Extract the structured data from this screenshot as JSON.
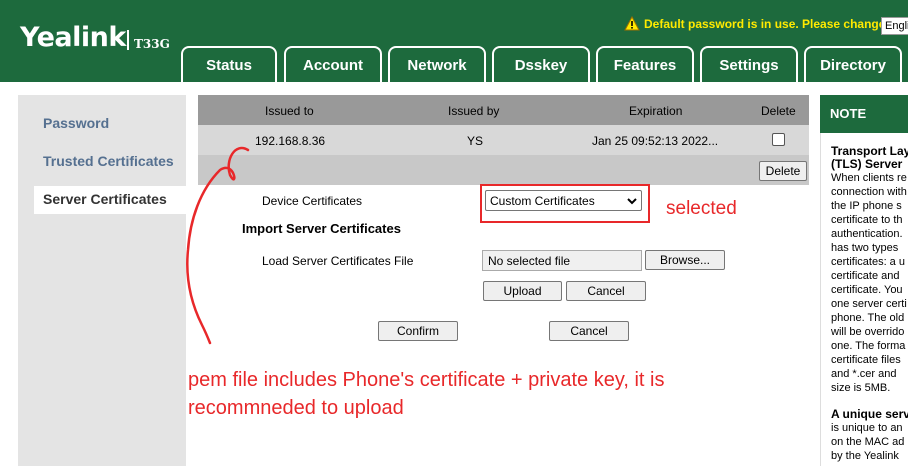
{
  "header": {
    "logo": "Yealink",
    "model": "T33G",
    "warning": "Default password is in use. Please change!",
    "language": "English",
    "tabs": [
      "Status",
      "Account",
      "Network",
      "Dsskey",
      "Features",
      "Settings",
      "Directory"
    ],
    "active_tab": "Settings"
  },
  "sidebar": {
    "items": [
      "Password",
      "Trusted Certificates",
      "Server Certificates"
    ],
    "active": "Server Certificates"
  },
  "cert_table": {
    "headers": [
      "Issued to",
      "Issued by",
      "Expiration",
      "Delete"
    ],
    "rows": [
      {
        "issued_to": "192.168.8.36",
        "issued_by": "YS",
        "expiration": "Jan 25 09:52:13 2022...",
        "delete_checked": false
      }
    ],
    "delete_button": "Delete"
  },
  "form": {
    "device_cert_label": "Device Certificates",
    "device_cert_value": "Custom Certificates",
    "import_title": "Import Server Certificates",
    "load_label": "Load Server Certificates File",
    "file_value": "No selected file",
    "browse": "Browse...",
    "upload": "Upload",
    "cancel_upload": "Cancel",
    "confirm": "Confirm",
    "cancel": "Cancel"
  },
  "annotations": {
    "selected": "selected",
    "pem_line1": "pem file includes Phone's certificate + private key, it is",
    "pem_line2": "recommneded to upload",
    "color": "#e8282a"
  },
  "note_panel": {
    "title": "NOTE",
    "heading1": "Transport Lay",
    "heading2": "(TLS) Server",
    "lines": [
      "When clients re",
      "connection with",
      "the IP phone s",
      "certificate to th",
      "authentication.",
      "has two types",
      "certificates: a u",
      "certificate and",
      "certificate. You",
      "one server certi",
      "phone. The old",
      "will be overrido",
      "one. The forma",
      "certificate files",
      "and *.cer and",
      "size is 5MB."
    ],
    "heading3": "A unique serv",
    "lines2": [
      "is unique to an",
      "on the MAC ad",
      "by the Yealink"
    ]
  },
  "colors": {
    "brand_green": "#1d6a3d",
    "warning_yellow": "#ffea00",
    "nav_text": "#557090"
  }
}
